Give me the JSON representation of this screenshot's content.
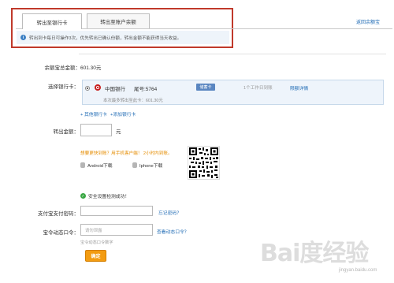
{
  "tabs": [
    {
      "label": "转出至银行卡",
      "active": true
    },
    {
      "label": "转出至账户余额",
      "active": false
    }
  ],
  "back_link": "返回余额宝",
  "notice": "转出到卡每日可操作3次，优先转出已确认份额，转出金额不能获得当天收益。",
  "balance": {
    "label": "余额宝总金额：",
    "value": "601.30元"
  },
  "bank_card": {
    "label": "选择银行卡：",
    "bank_name": "中国银行",
    "tail": "尾号:5764",
    "badge": "储蓄卡",
    "arrival": "1个工作日到账",
    "limit_link": "限额详情",
    "sub_text": "本次最多转出至此卡：601.30元"
  },
  "card_links": {
    "other": "+ 其他银行卡",
    "add": "+添加银行卡"
  },
  "amount": {
    "label": "转出金额：",
    "value": "",
    "unit": "元"
  },
  "promo_text": "想要更快到账？用手机客户端！ 2小时内到账。",
  "apps": {
    "android": "Android下载",
    "iphone": "Iphone下载"
  },
  "security_text": "安全设置检测成功！",
  "password": {
    "label": "支付宝支付密码：",
    "value": "",
    "forgot": "忘记密码？"
  },
  "otp": {
    "label": "宝令动态口令：",
    "placeholder": "请勿泄露",
    "link": "查看动态口令？",
    "hint": "宝令动态口令数字"
  },
  "confirm_label": "确定",
  "watermark": "Bai度经验",
  "watermark_sub": "jingyan.baidu.com",
  "colors": {
    "accent_blue": "#1f6bb5",
    "highlight_red": "#c0392b",
    "confirm_orange": "#f39c12"
  }
}
